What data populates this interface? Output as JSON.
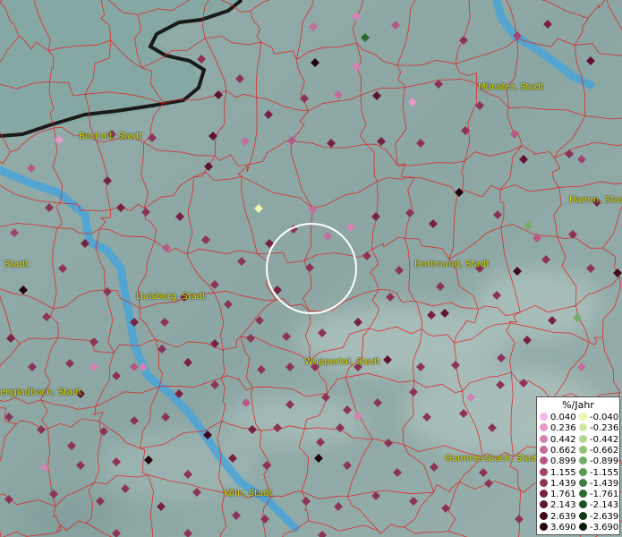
{
  "cities": [
    {
      "name": "Münster, Stadt"
    },
    {
      "name": "Bocholt, Stadt"
    },
    {
      "name": "Hamm, Stadt"
    },
    {
      "name": "Stadt"
    },
    {
      "name": "Duisburg, Stadt"
    },
    {
      "name": "Dortmund, Stadt"
    },
    {
      "name": "Wuppertal, Stadt"
    },
    {
      "name": "engladbach, Stadt"
    },
    {
      "name": "Gummersbach, Stadt"
    },
    {
      "name": "Köln, Stadt"
    }
  ],
  "legend": {
    "title": "%/Jahr",
    "positive": [
      {
        "label": "0.040",
        "color": "#f4b8e8"
      },
      {
        "label": "0.236",
        "color": "#e39ac9"
      },
      {
        "label": "0.442",
        "color": "#d482b4"
      },
      {
        "label": "0.662",
        "color": "#c36d9c"
      },
      {
        "label": "0.899",
        "color": "#b45a86"
      },
      {
        "label": "1.155",
        "color": "#9f4470"
      },
      {
        "label": "1.439",
        "color": "#8c3358"
      },
      {
        "label": "1.761",
        "color": "#772244"
      },
      {
        "label": "2.143",
        "color": "#5e1430"
      },
      {
        "label": "2.639",
        "color": "#420a1c"
      },
      {
        "label": "3.690",
        "color": "#24040c"
      }
    ],
    "negative": [
      {
        "label": "-0.040",
        "color": "#eef5b0"
      },
      {
        "label": "-0.236",
        "color": "#cfe6a0"
      },
      {
        "label": "-0.442",
        "color": "#b2d78e"
      },
      {
        "label": "-0.662",
        "color": "#92c27a"
      },
      {
        "label": "-0.899",
        "color": "#74ad66"
      },
      {
        "label": "-1.155",
        "color": "#579852"
      },
      {
        "label": "-1.439",
        "color": "#3d8040"
      },
      {
        "label": "-1.761",
        "color": "#286a30"
      },
      {
        "label": "-2.143",
        "color": "#185222"
      },
      {
        "label": "-2.639",
        "color": "#0c3a15"
      },
      {
        "label": "-3.690",
        "color": "#041e08"
      }
    ]
  },
  "colors": {
    "water": "#7fb3c9",
    "river": "#4aa3d8",
    "borders": "#e02020",
    "country_border": "#1a1a1a"
  }
}
